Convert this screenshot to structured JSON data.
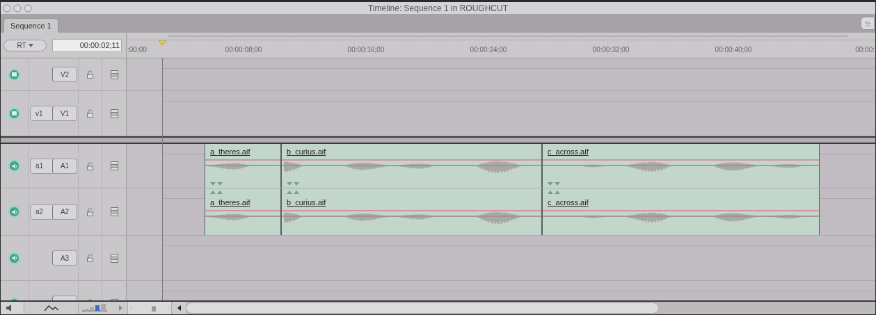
{
  "window": {
    "title": "Timeline: Sequence 1 in ROUGHCUT"
  },
  "tabs": [
    {
      "label": "Sequence 1",
      "selected": true
    }
  ],
  "rt_menu": "RT",
  "timecode": "00:00:02;11",
  "ruler": {
    "labels": [
      ":00;00",
      "00:00:08;00",
      "00:00:16;00",
      "00:00:24;00",
      "00:00:32;00",
      "00:00:40;00",
      "00:00:"
    ]
  },
  "video_tracks": [
    {
      "kind": "video",
      "dest": "V2"
    },
    {
      "kind": "video",
      "source": "v1",
      "dest": "V1"
    }
  ],
  "audio_tracks": [
    {
      "kind": "audio",
      "source": "a1",
      "dest": "A1",
      "clips": [
        {
          "name": "a_theres.aif"
        },
        {
          "name": "b_curius.aif"
        },
        {
          "name": "c_across.aif"
        }
      ]
    },
    {
      "kind": "audio",
      "source": "a2",
      "dest": "A2",
      "clips": [
        {
          "name": "a_theres.aif"
        },
        {
          "name": "b_curius.aif"
        },
        {
          "name": "c_across.aif"
        }
      ]
    },
    {
      "kind": "audio",
      "dest": "A3"
    },
    {
      "kind": "audio"
    }
  ],
  "zoom_slider": {
    "level": 0.6
  }
}
